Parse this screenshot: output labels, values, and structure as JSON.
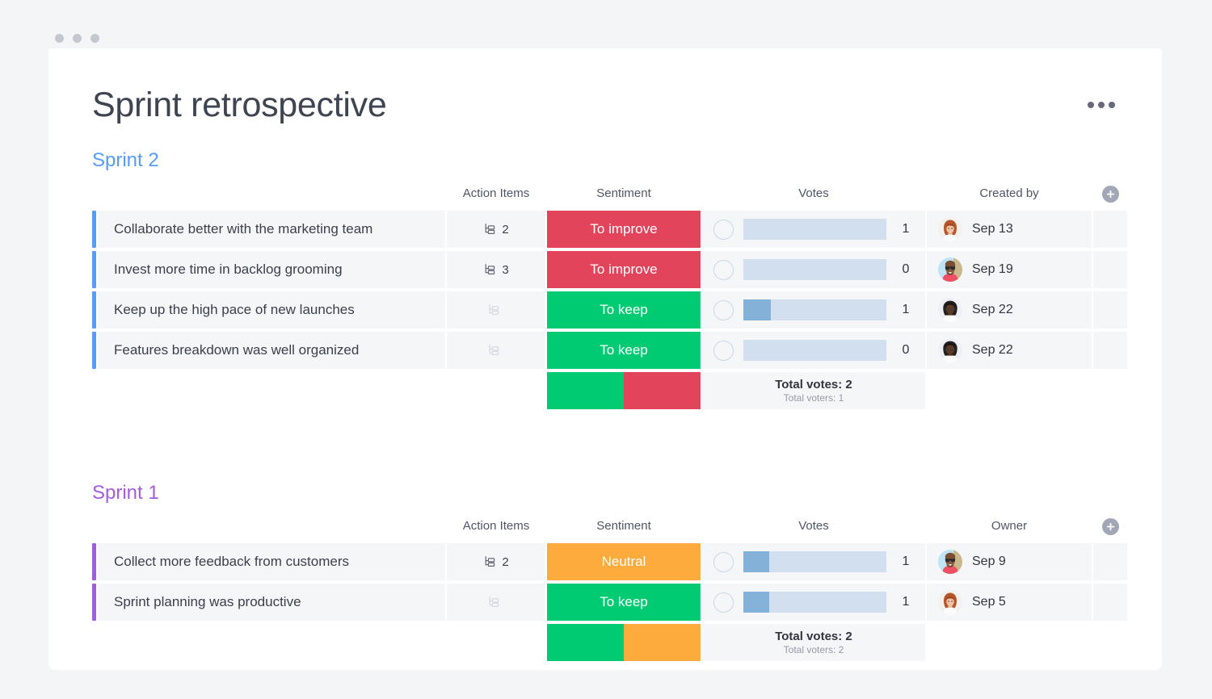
{
  "window": {
    "dots": [
      "minimize-dot",
      "maximize-dot",
      "close-dot"
    ]
  },
  "header": {
    "title": "Sprint retrospective",
    "menu_icon": "kebab-menu-icon"
  },
  "colors": {
    "accent_blue": "#579bfc",
    "accent_purple": "#a25ddc",
    "sentiment_improve": "#e2445c",
    "sentiment_keep": "#00ca72",
    "sentiment_neutral": "#fdab3d",
    "vote_bar_track": "#d2dfee",
    "vote_bar_fill": "#84b1d8",
    "cell_bg": "#f5f6f8",
    "page_bg": "#f4f5f7"
  },
  "boards": [
    {
      "group_name": "Sprint 2",
      "group_color": "#579bfc",
      "accent_class": "accent-blue",
      "add_column_icon": "plus-icon",
      "columns": [
        {
          "key": "name",
          "label": ""
        },
        {
          "key": "action",
          "label": "Action Items"
        },
        {
          "key": "sent",
          "label": "Sentiment"
        },
        {
          "key": "votes",
          "label": "Votes"
        },
        {
          "key": "owner",
          "label": "Created by"
        }
      ],
      "rows": [
        {
          "name": "Collaborate better with the marketing team",
          "action_items": "2",
          "has_action_items": true,
          "sentiment": "To improve",
          "sentiment_color": "#e2445c",
          "vote_fill_percent": 0,
          "vote_count": "1",
          "avatar": "avatar-redhair-woman",
          "date": "Sep 13"
        },
        {
          "name": "Invest more time in backlog grooming",
          "action_items": "3",
          "has_action_items": true,
          "sentiment": "To improve",
          "sentiment_color": "#e2445c",
          "vote_fill_percent": 0,
          "vote_count": "0",
          "avatar": "avatar-bald-man-sunglasses",
          "date": "Sep 19"
        },
        {
          "name": "Keep up the high pace of new launches",
          "action_items": "",
          "has_action_items": false,
          "sentiment": "To keep",
          "sentiment_color": "#00ca72",
          "vote_fill_percent": 19,
          "vote_count": "1",
          "avatar": "avatar-woman-glasses",
          "date": "Sep 22"
        },
        {
          "name": "Features breakdown was well organized",
          "action_items": "",
          "has_action_items": false,
          "sentiment": "To keep",
          "sentiment_color": "#00ca72",
          "vote_fill_percent": 0,
          "vote_count": "0",
          "avatar": "avatar-woman-glasses",
          "date": "Sep 22"
        }
      ],
      "summary": {
        "segments": [
          {
            "color": "#00ca72",
            "percent": 50
          },
          {
            "color": "#e2445c",
            "percent": 50
          }
        ],
        "total_votes": "Total votes: 2",
        "total_voters": "Total voters: 1"
      }
    },
    {
      "group_name": "Sprint 1",
      "group_color": "#a25ddc",
      "accent_class": "accent-purple",
      "add_column_icon": "plus-icon",
      "columns": [
        {
          "key": "name",
          "label": ""
        },
        {
          "key": "action",
          "label": "Action Items"
        },
        {
          "key": "sent",
          "label": "Sentiment"
        },
        {
          "key": "votes",
          "label": "Votes"
        },
        {
          "key": "owner",
          "label": "Owner"
        }
      ],
      "rows": [
        {
          "name": "Collect more feedback from customers",
          "action_items": "2",
          "has_action_items": true,
          "sentiment": "Neutral",
          "sentiment_color": "#fdab3d",
          "vote_fill_percent": 18,
          "vote_count": "1",
          "avatar": "avatar-bald-man-sunglasses",
          "date": "Sep 9"
        },
        {
          "name": "Sprint planning was productive",
          "action_items": "",
          "has_action_items": false,
          "sentiment": "To keep",
          "sentiment_color": "#00ca72",
          "vote_fill_percent": 18,
          "vote_count": "1",
          "avatar": "avatar-redhair-woman",
          "date": "Sep 5"
        }
      ],
      "summary": {
        "segments": [
          {
            "color": "#00ca72",
            "percent": 50
          },
          {
            "color": "#fdab3d",
            "percent": 50
          }
        ],
        "total_votes": "Total votes: 2",
        "total_voters": "Total voters: 2"
      }
    }
  ]
}
